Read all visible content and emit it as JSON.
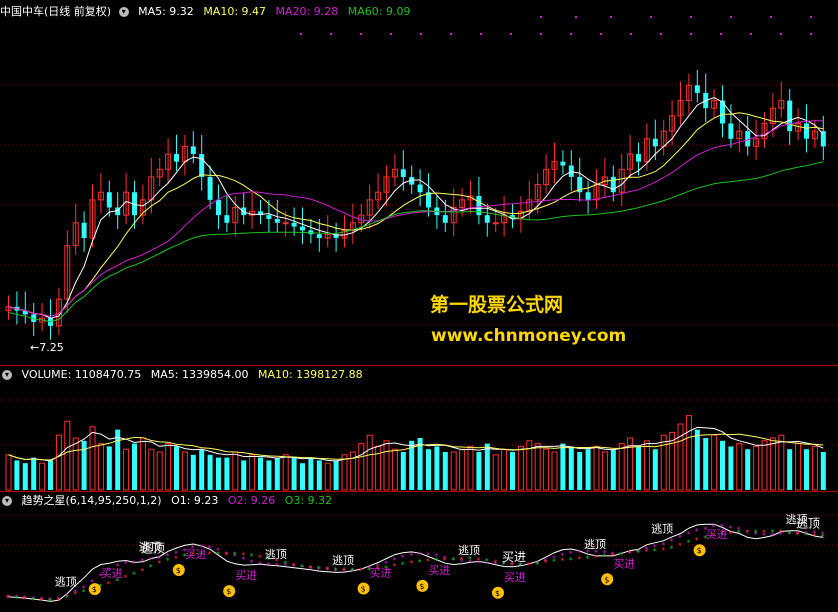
{
  "price_panel": {
    "stock_label": "中国中车(日线 前复权)",
    "ma5_label": "MA5: 9.32",
    "ma10_label": "MA10: 9.47",
    "ma20_label": "MA20: 9.28",
    "ma60_label": "MA60: 9.09",
    "low_label": "7.25",
    "colors": {
      "ma5": "#ffffff",
      "ma10": "#ffff60",
      "ma20": "#d020d0",
      "ma60": "#20c020",
      "up": "#ff3030",
      "down": "#30ffff"
    }
  },
  "watermark": {
    "line1": "第一股票公式网",
    "line2": "www.chnmoney.com"
  },
  "volume_panel": {
    "volume_label": "VOLUME: 1108470.75",
    "ma5_label": "MA5: 1339854.00",
    "ma10_label": "MA10: 1398127.88"
  },
  "indicator_panel": {
    "name_label": "趋势之星(6,14,95,250,1,2)",
    "o1_label": "O1: 9.23",
    "o2_label": "O2: 9.26",
    "o3_label": "O3: 9.32",
    "escape_label": "逃顶",
    "buy_label": "买进",
    "money_icon": "money-bag-icon"
  },
  "chart_data": {
    "type": "candlestick",
    "low_marker": 7.25,
    "price_range": [
      7.0,
      10.6
    ],
    "closes": [
      7.5,
      7.45,
      7.4,
      7.3,
      7.35,
      7.25,
      7.6,
      8.3,
      8.6,
      8.4,
      8.9,
      9.0,
      8.8,
      8.7,
      9.0,
      8.7,
      8.9,
      9.2,
      9.3,
      9.5,
      9.4,
      9.6,
      9.5,
      9.2,
      8.9,
      8.7,
      8.6,
      8.8,
      8.7,
      8.75,
      8.7,
      8.65,
      8.6,
      8.6,
      8.55,
      8.5,
      8.45,
      8.4,
      8.45,
      8.4,
      8.5,
      8.6,
      8.7,
      8.9,
      9.0,
      9.2,
      9.3,
      9.2,
      9.1,
      9.0,
      8.8,
      8.7,
      8.6,
      8.8,
      8.9,
      8.95,
      8.7,
      8.6,
      8.6,
      8.7,
      8.65,
      8.75,
      8.9,
      9.1,
      9.3,
      9.4,
      9.35,
      9.2,
      9.0,
      8.9,
      9.1,
      9.2,
      9.0,
      9.3,
      9.5,
      9.4,
      9.7,
      9.6,
      9.8,
      10.0,
      10.2,
      10.4,
      10.3,
      10.1,
      10.2,
      9.9,
      9.7,
      9.8,
      9.6,
      9.7,
      9.9,
      10.1,
      10.2,
      9.8,
      9.9,
      9.7,
      9.8,
      9.6
    ],
    "volumes": [
      0.9,
      0.7,
      0.6,
      0.8,
      0.6,
      0.7,
      1.6,
      2.1,
      1.5,
      1.4,
      1.9,
      1.3,
      1.2,
      1.8,
      1.1,
      1.3,
      1.5,
      1.1,
      1.0,
      1.3,
      1.2,
      1.0,
      0.9,
      1.1,
      0.9,
      0.8,
      0.8,
      1.0,
      0.7,
      0.9,
      0.8,
      0.7,
      0.8,
      0.9,
      0.8,
      0.6,
      0.8,
      0.7,
      0.6,
      0.7,
      0.9,
      1.0,
      1.3,
      1.6,
      1.2,
      1.4,
      1.1,
      1.0,
      1.4,
      1.5,
      1.1,
      1.2,
      1.0,
      1.0,
      1.1,
      1.2,
      1.0,
      1.3,
      0.9,
      1.1,
      1.0,
      1.2,
      1.4,
      1.3,
      1.1,
      1.0,
      1.3,
      1.2,
      1.0,
      1.1,
      1.2,
      1.0,
      1.1,
      1.3,
      1.5,
      1.2,
      1.4,
      1.1,
      1.6,
      1.7,
      2.0,
      2.3,
      1.8,
      1.5,
      1.6,
      1.4,
      1.2,
      1.3,
      1.1,
      1.2,
      1.4,
      1.5,
      1.6,
      1.1,
      1.3,
      1.1,
      1.2,
      1.0
    ]
  }
}
